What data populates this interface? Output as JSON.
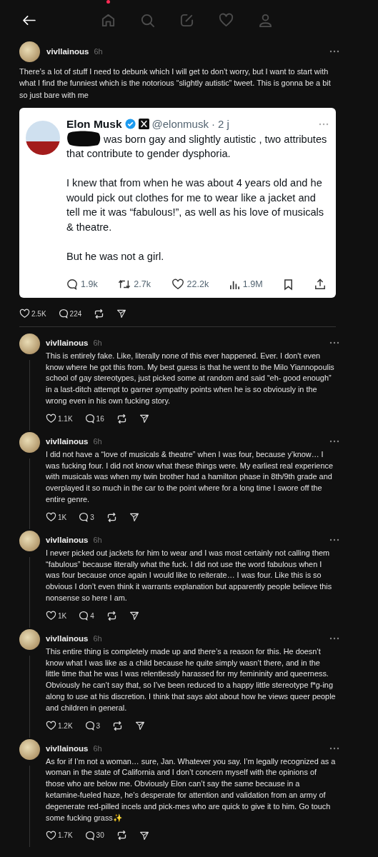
{
  "nav": {
    "items": [
      {
        "kind": "home",
        "unread": true
      },
      {
        "kind": "search",
        "unread": false
      },
      {
        "kind": "compose",
        "unread": false
      },
      {
        "kind": "activity",
        "unread": false
      },
      {
        "kind": "profile",
        "unread": false
      }
    ]
  },
  "post": {
    "author": "vivllainous",
    "time": "6h",
    "text": "There’s a lot of stuff I need to debunk which I will get to don’t worry, but I want to start with what I find the funniest which is the notorious “slightly autistic” tweet. This is gonna be a bit so just bare with me",
    "quoted_tweet": {
      "author": "Elon Musk",
      "verified": true,
      "handle": "@elonmusk",
      "dot": "·",
      "time": "2 j",
      "redacted": true,
      "paragraphs": [
        "was born gay and slightly autistic , two attributes that contribute to gender dysphoria.",
        "I knew that from when he was about 4 years old and he would pick out clothes for me to wear like a jacket and tell me it was “fabulous!”, as well as his love of musicals & theatre.",
        "But he was not a girl."
      ],
      "stats": [
        {
          "kind": "reply",
          "value": "1.9k"
        },
        {
          "kind": "repost",
          "value": "2.7k"
        },
        {
          "kind": "like",
          "value": "22.2k"
        },
        {
          "kind": "views",
          "value": "1.9M"
        },
        {
          "kind": "bookmark"
        },
        {
          "kind": "share"
        }
      ]
    },
    "likes": "2.5K",
    "replies": "224"
  },
  "replies": [
    {
      "author": "vivllainous",
      "time": "6h",
      "text": "This is entirely fake. Like, literally none of this ever happened. Ever. I don't even know where he got this from. My best guess is that he went to the Milo Yiannopoulis school of gay stereotypes, just picked some at random and said “eh- good enough” in a last-ditch attempt to garner sympathy points when he is so obviously in the wrong even in his own fucking story.",
      "likes": "1.1K",
      "replies": "16"
    },
    {
      "author": "vivllainous",
      "time": "6h",
      "text": "I did not have a “love of musicals & theatre” when I was four, because y’know… I was fucking four. I did not know what these things were. My earliest real experience with musicals was when my twin brother had a hamilton phase in 8th/9th grade and overplayed it so much in the car to the point where for a long time I swore off the entire genre.",
      "likes": "1K",
      "replies": "3"
    },
    {
      "author": "vivllainous",
      "time": "6h",
      "text": "I never picked out jackets for him to wear and I was most certainly not calling them “fabulous” because literally what the fuck. I did not use the word fabulous when I was four because once again I would like to reiterate… I was four. Like this is so obvious I don’t even think it warrants explanation but apparently people believe this nonsense so here I am.",
      "likes": "1K",
      "replies": "4"
    },
    {
      "author": "vivllainous",
      "time": "6h",
      "text": "This entire thing is completely made up and there’s a reason for this. He doesn’t know what I was like as a child because he quite simply wasn’t there, and in the little time that he was I was relentlessly harassed for my femininity and queerness. Obviously he can’t say that, so I’ve been reduced to a happy little stereotype f*g-ing along to use at his discretion. I think that says alot about how he views queer people and children in general.",
      "likes": "1.2K",
      "replies": "3"
    },
    {
      "author": "vivllainous",
      "time": "6h",
      "text": "As for if I’m not a woman… sure, Jan. Whatever you say. I’m legally recognized as a woman in the state of California and I don’t concern myself with the opinions of those who are below me. Obviously Elon can’t say the same because in a ketamine-fueled haze, he’s desperate for attention and validation from an army of degenerate red-pilled incels and pick-mes who are quick to give it to him. Go touch some fucking grass✨",
      "likes": "1.7K",
      "replies": "30"
    }
  ]
}
